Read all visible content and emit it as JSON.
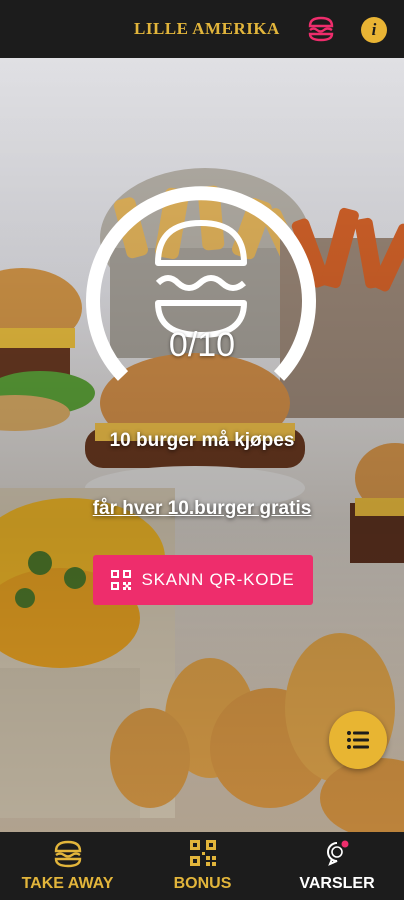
{
  "header": {
    "title": "LILLE AMERIKA",
    "burger_icon": "burger-icon",
    "info_icon": "info-icon",
    "info_glyph": "i"
  },
  "stamp_card": {
    "progress": "0/10",
    "progress_fraction": 0,
    "must_buy_text": "10 burger må kjøpes",
    "reward_text": "får hver 10.burger gratis",
    "scan_button_label": "SKANN QR-KODE"
  },
  "tabs": [
    {
      "label": "TAKE AWAY",
      "icon": "burger-icon",
      "active": false
    },
    {
      "label": "BONUS",
      "icon": "qr-code-icon",
      "active": false
    },
    {
      "label": "VARSLER",
      "icon": "notification-bell-icon",
      "active": true
    }
  ],
  "colors": {
    "brand_gold": "#e2b53b",
    "accent_pink": "#ee2d6c",
    "bar_background": "#1c1c1c"
  }
}
